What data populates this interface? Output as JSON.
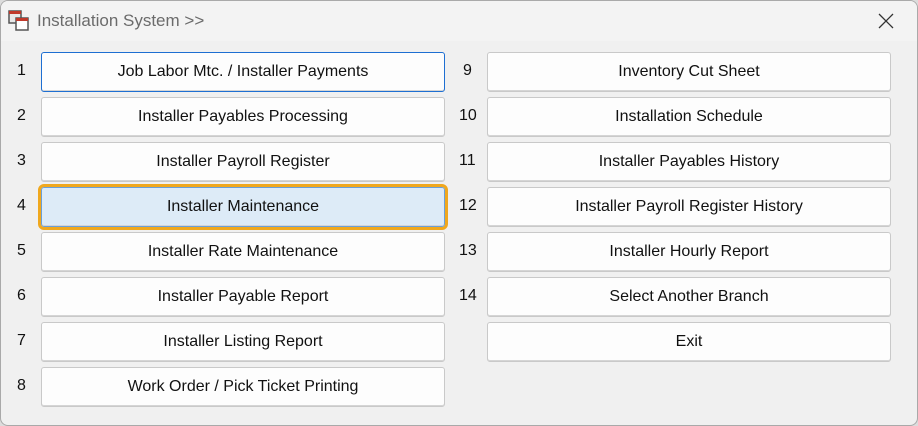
{
  "window": {
    "title": "Installation System >>",
    "close_glyph": "✕",
    "icon": "app-window-icon"
  },
  "menu": {
    "left": [
      {
        "num": "1",
        "label": "Job Labor Mtc. / Installer Payments",
        "state": "default"
      },
      {
        "num": "2",
        "label": "Installer Payables Processing",
        "state": ""
      },
      {
        "num": "3",
        "label": "Installer Payroll Register",
        "state": ""
      },
      {
        "num": "4",
        "label": "Installer Maintenance",
        "state": "focused"
      },
      {
        "num": "5",
        "label": "Installer Rate Maintenance",
        "state": ""
      },
      {
        "num": "6",
        "label": "Installer Payable Report",
        "state": ""
      },
      {
        "num": "7",
        "label": "Installer Listing Report",
        "state": ""
      },
      {
        "num": "8",
        "label": "Work Order / Pick Ticket Printing",
        "state": ""
      }
    ],
    "right": [
      {
        "num": "9",
        "label": "Inventory Cut Sheet"
      },
      {
        "num": "10",
        "label": "Installation Schedule"
      },
      {
        "num": "11",
        "label": "Installer Payables History"
      },
      {
        "num": "12",
        "label": "Installer Payroll Register History"
      },
      {
        "num": "13",
        "label": "Installer Hourly Report"
      },
      {
        "num": "14",
        "label": "Select Another Branch"
      },
      {
        "num": "",
        "label": "Exit"
      }
    ]
  },
  "colors": {
    "focus_outline": "#f0a81e",
    "focus_fill": "#ddebf7",
    "default_border": "#1e6fd2"
  }
}
